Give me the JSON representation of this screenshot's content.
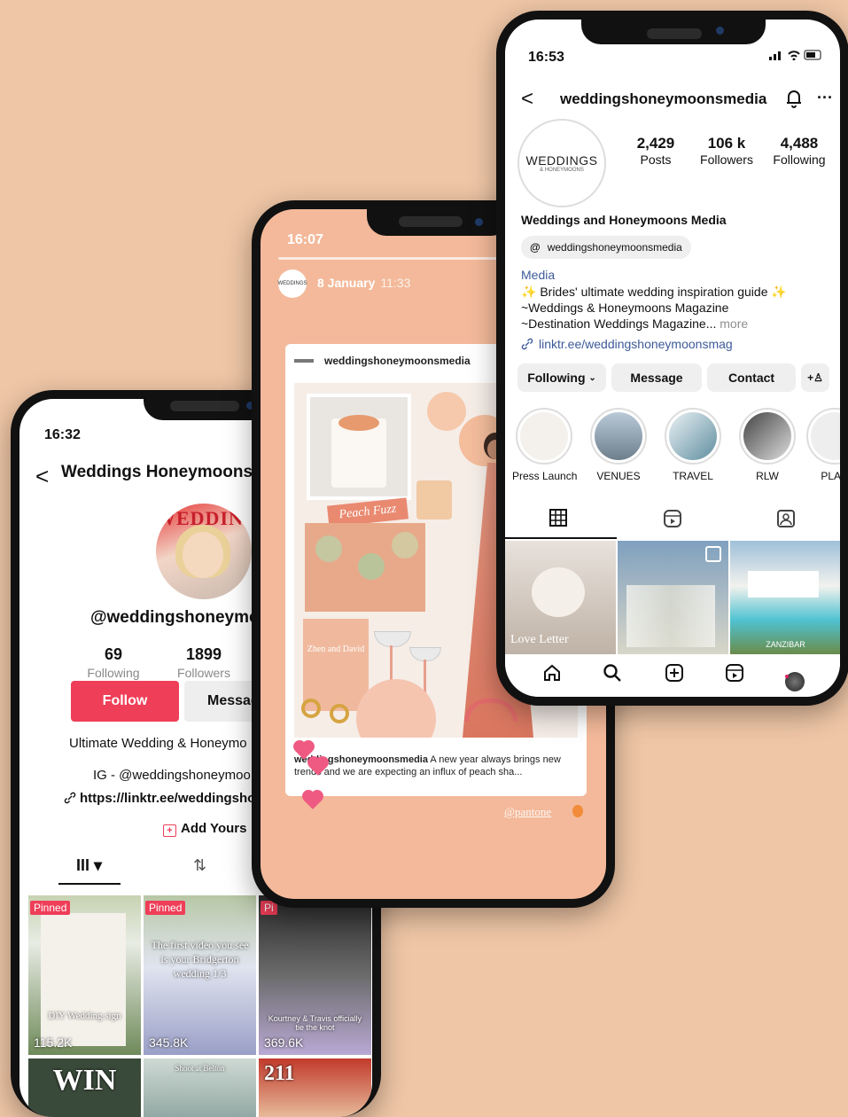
{
  "tiktok": {
    "time": "16:32",
    "back": "<",
    "title": "Weddings Honeymoons",
    "avatar_masthead": "WEDDING",
    "handle": "@weddingshoneymoo",
    "following_count": "69",
    "following_label": "Following",
    "followers_count": "1899",
    "followers_label": "Followers",
    "follow_label": "Follow",
    "message_label": "Message",
    "bio": "Ultimate Wedding & Honeymo",
    "ig": "IG - @weddingshoneymoo",
    "link": "https://linktr.ee/weddingsho",
    "add_yours": "Add Yours",
    "tabs": [
      "III",
      "⇅"
    ],
    "videos": [
      {
        "badge": "Pinned",
        "caption": "DIY Wedding sign",
        "views": "115.2K"
      },
      {
        "badge": "Pinned",
        "caption": "The first video you see is your Bridgerton wedding 1/3",
        "views": "345.8K"
      },
      {
        "badge": "Pi",
        "caption": "Kourtney & Travis officially tie the knot",
        "views": "369.6K"
      },
      {
        "caption": "WIN"
      },
      {
        "caption": "Shoot at Belton"
      },
      {
        "caption": "211"
      }
    ]
  },
  "story": {
    "time": "16:07",
    "date": "8 January",
    "clock": "11:33",
    "post_user": "weddingshoneymoonsmedia",
    "board_sticker": "Peach Fuzz",
    "card_text": "Zhen and David",
    "caption_user": "weddingshoneymoonsmedia",
    "caption_text": "A new year always brings new trends and we are expecting an influx of peach sha...",
    "tag": "@pantone"
  },
  "instagram": {
    "time": "16:53",
    "back": "<",
    "username": "weddingshoneymoonsmedia",
    "avatar_word": "WEDDINGS",
    "avatar_sub": "& HONEYMOONS",
    "posts_count": "2,429",
    "posts_label": "Posts",
    "followers_count": "106 k",
    "followers_label": "Followers",
    "following_count": "4,488",
    "following_label": "Following",
    "display_name": "Weddings and Honeymoons Media",
    "threads_handle": "weddingshoneymoonsmedia",
    "category": "Media",
    "bio_line1": "✨ Brides' ultimate wedding inspiration guide ✨",
    "bio_line2": "~Weddings & Honeymoons Magazine",
    "bio_line3": "~Destination Weddings Magazine...",
    "bio_more": "more",
    "link": "linktr.ee/weddingshoneymoonsmag",
    "btn_following": "Following",
    "btn_message": "Message",
    "btn_contact": "Contact",
    "highlights": [
      "Press Launch",
      "VENUES",
      "TRAVEL",
      "RLW",
      "PLAN"
    ],
    "posts": [
      {
        "caption": "Love Letter"
      },
      {
        "caption": ""
      },
      {
        "caption": "ZANZIBAR"
      }
    ]
  },
  "icons": [
    "back-icon",
    "bell-icon",
    "more-icon",
    "grid-icon",
    "reels-icon",
    "tagged-icon",
    "home-icon",
    "search-icon",
    "create-icon",
    "reels-nav-icon",
    "profile-icon",
    "link-icon",
    "threads-icon",
    "add-friend-icon",
    "add-yours-icon",
    "repost-icon"
  ],
  "colors": {
    "background": "#efc6a6",
    "tiktok_red": "#ef3e58",
    "ig_link": "#3d5a99",
    "story_bg": "#f3b99a"
  }
}
